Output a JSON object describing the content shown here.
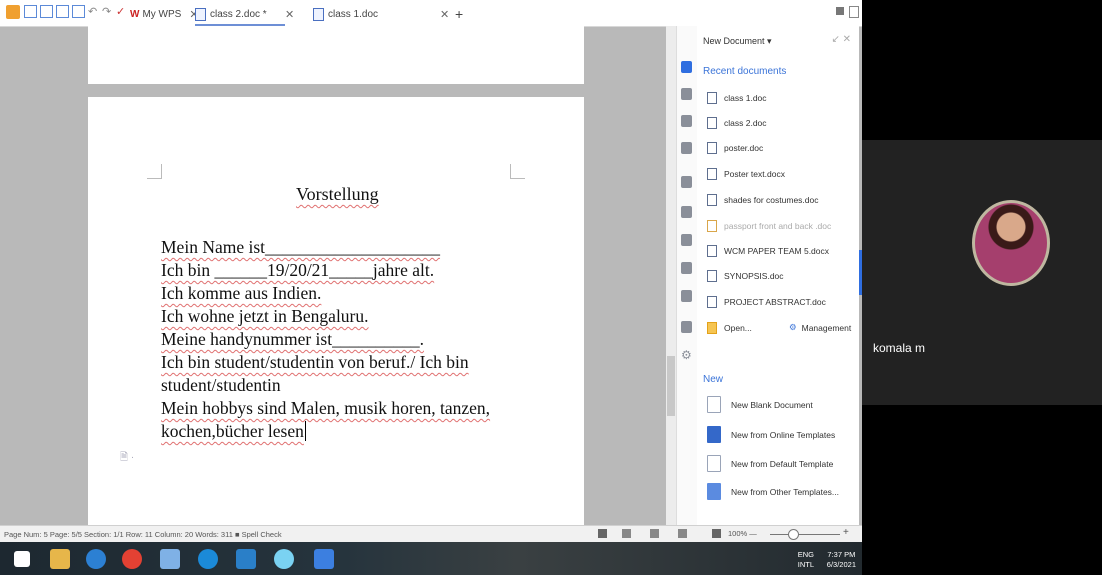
{
  "titlebar": {
    "tabs": [
      {
        "label": "My WPS",
        "active": false
      },
      {
        "label": "class 2.doc *",
        "active": true
      },
      {
        "label": "class 1.doc",
        "active": false
      }
    ],
    "new_tab": "+"
  },
  "document": {
    "title": "Vorstellung",
    "lines": [
      "Mein Name ist____________________",
      "Ich bin ______19/20/21_____jahre alt.",
      "Ich komme aus Indien.",
      "Ich wohne jetzt in Bengaluru.",
      "Meine handynummer ist__________.",
      "Ich bin student/studentin von beruf./ Ich bin",
      "student/studentin",
      "Mein hobbys sind Malen, musik horen, tanzen,",
      "kochen,bücher lesen"
    ]
  },
  "panel": {
    "header": "New Document ▾",
    "controls": "↙ ✕",
    "recent_title": "Recent documents",
    "recent": [
      {
        "name": "class 1.doc",
        "dim": false
      },
      {
        "name": "class 2.doc",
        "dim": false
      },
      {
        "name": "poster.doc",
        "dim": false
      },
      {
        "name": "Poster text.docx",
        "dim": false
      },
      {
        "name": "shades for costumes.doc",
        "dim": false
      },
      {
        "name": "passport front and back .doc",
        "dim": true
      },
      {
        "name": "WCM PAPER TEAM 5.docx",
        "dim": false
      },
      {
        "name": "SYNOPSIS.doc",
        "dim": false
      },
      {
        "name": "PROJECT ABSTRACT.doc",
        "dim": false
      }
    ],
    "open_label": "Open...",
    "management_label": "Management",
    "new_title": "New",
    "new_items": [
      "New Blank Document",
      "New from Online Templates",
      "New from Default Template",
      "New from Other Templates..."
    ]
  },
  "status": {
    "text": "Page Num: 5   Page: 5/5   Section: 1/1   Row: 11   Column: 20   Words: 311   ■ Spell Check",
    "zoom": "100% —"
  },
  "tray": {
    "lang1": "ENG",
    "lang2": "INTL",
    "time": "7:37 PM",
    "date": "6/3/2021"
  },
  "video": {
    "participant": "komala m"
  },
  "colors": {
    "accent": "#2f6ee0",
    "link": "#3b74d8",
    "spell_underline": "#e07070"
  }
}
